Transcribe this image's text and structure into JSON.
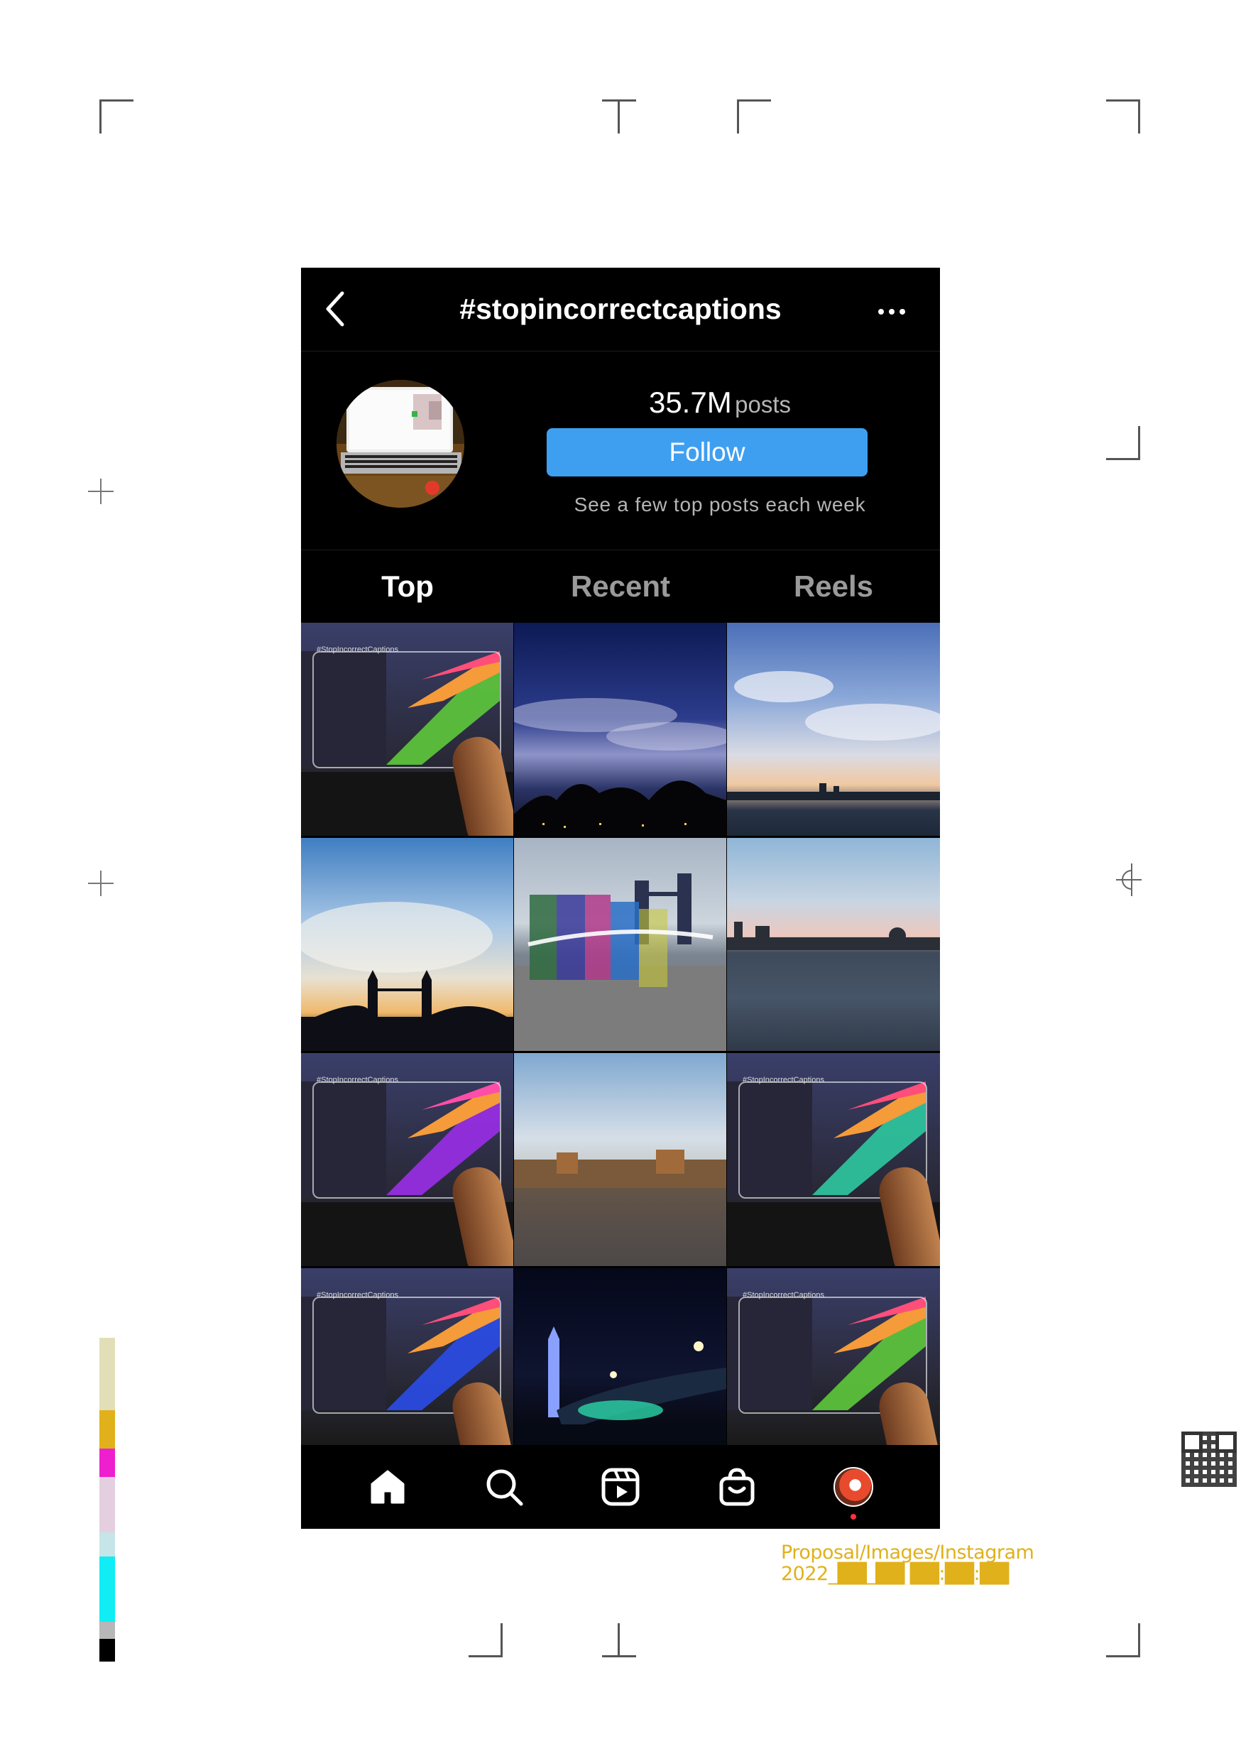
{
  "header": {
    "title": "#stopincorrectcaptions",
    "back_icon": "chevron-left-icon",
    "more_icon": "more-horizontal-icon"
  },
  "profile": {
    "post_count": "35.7M",
    "post_label": "posts",
    "follow_label": "Follow",
    "hint": "See a few top posts each week"
  },
  "tabs": [
    {
      "label": "Top",
      "active": true
    },
    {
      "label": "Recent",
      "active": false
    },
    {
      "label": "Reels",
      "active": false
    }
  ],
  "grid": {
    "caption_text": "#StopIncorrectCaptions",
    "chevron_text": ">>"
  },
  "nav": {
    "items": [
      "home-icon",
      "search-icon",
      "reels-icon",
      "shop-icon",
      "profile-avatar"
    ]
  },
  "footnote": {
    "line1": "Proposal/Images/Instagram",
    "line2": "2022_██_██ ██:██:██"
  },
  "colors": {
    "accent": "#3e9ff1",
    "background": "#000000",
    "footnote": "#e0b11b",
    "notification": "#ff3040"
  }
}
